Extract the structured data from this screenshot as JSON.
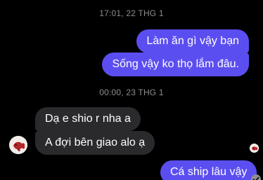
{
  "conversation": {
    "date_1": "17:01, 22 THG 1",
    "msg_1": "Làm ăn gì vậy bạn",
    "msg_2": "Sống vậy ko thọ lắm đâu.",
    "date_2": "00:00, 23 THG 1",
    "msg_3": "Dạ e shio r nha a",
    "msg_4": "A đợi bên giao alo ạ",
    "msg_5": "Cá ship lâu vậy"
  },
  "colors": {
    "outgoing_bubble": "#5b4ef0",
    "incoming_bubble": "#2a2a2c",
    "background": "#000000",
    "timestamp_text": "#8e8e93"
  },
  "icons": {
    "contact_avatar": "betta-fish-avatar-icon",
    "read_receipt": "seen-avatar-icon",
    "sent_status": "sent-check-icon"
  }
}
